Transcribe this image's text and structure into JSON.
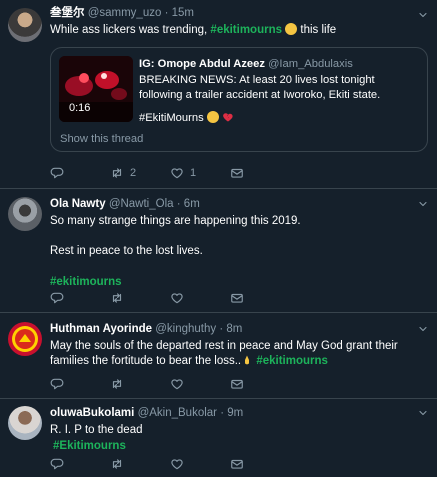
{
  "tweets": [
    {
      "name": "叁堡尔",
      "handle": "@sammy_uzo",
      "time": "15m",
      "text_before": "While ass lickers was trending, ",
      "hashtag": "#ekitimourns",
      "text_after": " this life",
      "quote": {
        "name": "IG: Omope Abdul Azeez",
        "handle": "@Iam_Abdulaxis",
        "body": "BREAKING NEWS: At least 20 lives lost tonight following a trailer accident at Iworoko, Ekiti state.",
        "tag_line": "#EkitiMourns",
        "video_duration": "0:16",
        "show_thread": "Show this thread"
      },
      "retweets": "2",
      "likes": "1"
    },
    {
      "name": "Ola Nawty",
      "handle": "@Nawti_Ola",
      "time": "6m",
      "line1": "So many strange things are happening this 2019.",
      "line2": "Rest in peace to the lost lives.",
      "hashtag": "#ekitimourns"
    },
    {
      "name": "Huthman Ayorinde",
      "handle": "@kinghuthy",
      "time": "8m",
      "text": "May the souls of the departed rest in peace and May God grant their families the fortitude to bear the loss..",
      "hashtag": "#ekitimourns"
    },
    {
      "name": "oluwaBukolami",
      "handle": "@Akin_Bukolar",
      "time": "9m",
      "text": "R. I. P to the dead",
      "hashtag": "#Ekitimourns"
    }
  ],
  "separator": "·",
  "colors": {
    "background": "#15202b",
    "border": "#38444d",
    "muted": "#8899a6",
    "hashtag": "#1db35b"
  },
  "icons": [
    "reply-icon",
    "retweet-icon",
    "like-icon",
    "message-icon",
    "chevron-down-icon"
  ]
}
